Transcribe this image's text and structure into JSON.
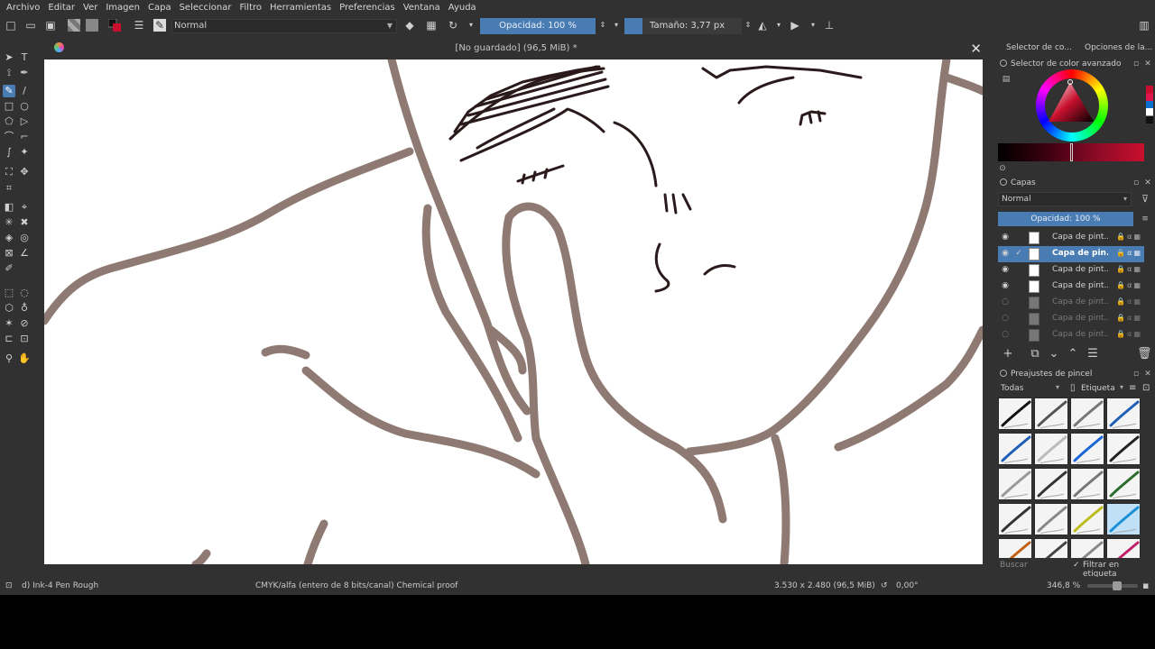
{
  "menu": [
    "Archivo",
    "Editar",
    "Ver",
    "Imagen",
    "Capa",
    "Seleccionar",
    "Filtro",
    "Herramientas",
    "Preferencias",
    "Ventana",
    "Ayuda"
  ],
  "toolbar": {
    "blend_mode": "Normal",
    "opacity_label": "Opacidad: 100 %",
    "size_label": "Tamaño: 3,77 px"
  },
  "document": {
    "title": "[No guardado]  (96,5 MiB) *"
  },
  "dock": {
    "tab_color_selector": "Selector de co...",
    "tab_tool_options": "Opciones de la...",
    "color_selector_title": "Selector de color avanzado",
    "layers_title": "Capas",
    "layers_blend": "Normal",
    "layers_opacity": "Opacidad:  100 %",
    "layers": [
      {
        "name": "Capa de pint...",
        "visible": true,
        "selected": false
      },
      {
        "name": "Capa de pin...",
        "visible": true,
        "selected": true
      },
      {
        "name": "Capa de pint...",
        "visible": true,
        "selected": false
      },
      {
        "name": "Capa de pint...",
        "visible": true,
        "selected": false
      },
      {
        "name": "Capa de pint...",
        "visible": false,
        "selected": false
      },
      {
        "name": "Capa de pint...",
        "visible": false,
        "selected": false
      },
      {
        "name": "Capa de pint...",
        "visible": false,
        "selected": false
      }
    ],
    "brush_presets_title": "Preajustes de pincel",
    "brush_filter_all": "Todas",
    "brush_filter_tag": "Etiqueta",
    "brush_search_placeholder": "Buscar",
    "brush_filter_in_tag": "Filtrar en etiqueta"
  },
  "status": {
    "brush_name": "d) Ink-4 Pen Rough",
    "color_space": "CMYK/alfa (entero de 8 bits/canal)  Chemical proof",
    "image_size": "3.530 x 2.480 (96,5 MiB)",
    "rotation": "0,00°",
    "zoom": "346,8 %"
  },
  "colors": {
    "accent": "#4a7cb4",
    "ui_bg": "#313131",
    "stroke_brown": "#8e7a72",
    "ink_dark": "#2a1a1c"
  }
}
